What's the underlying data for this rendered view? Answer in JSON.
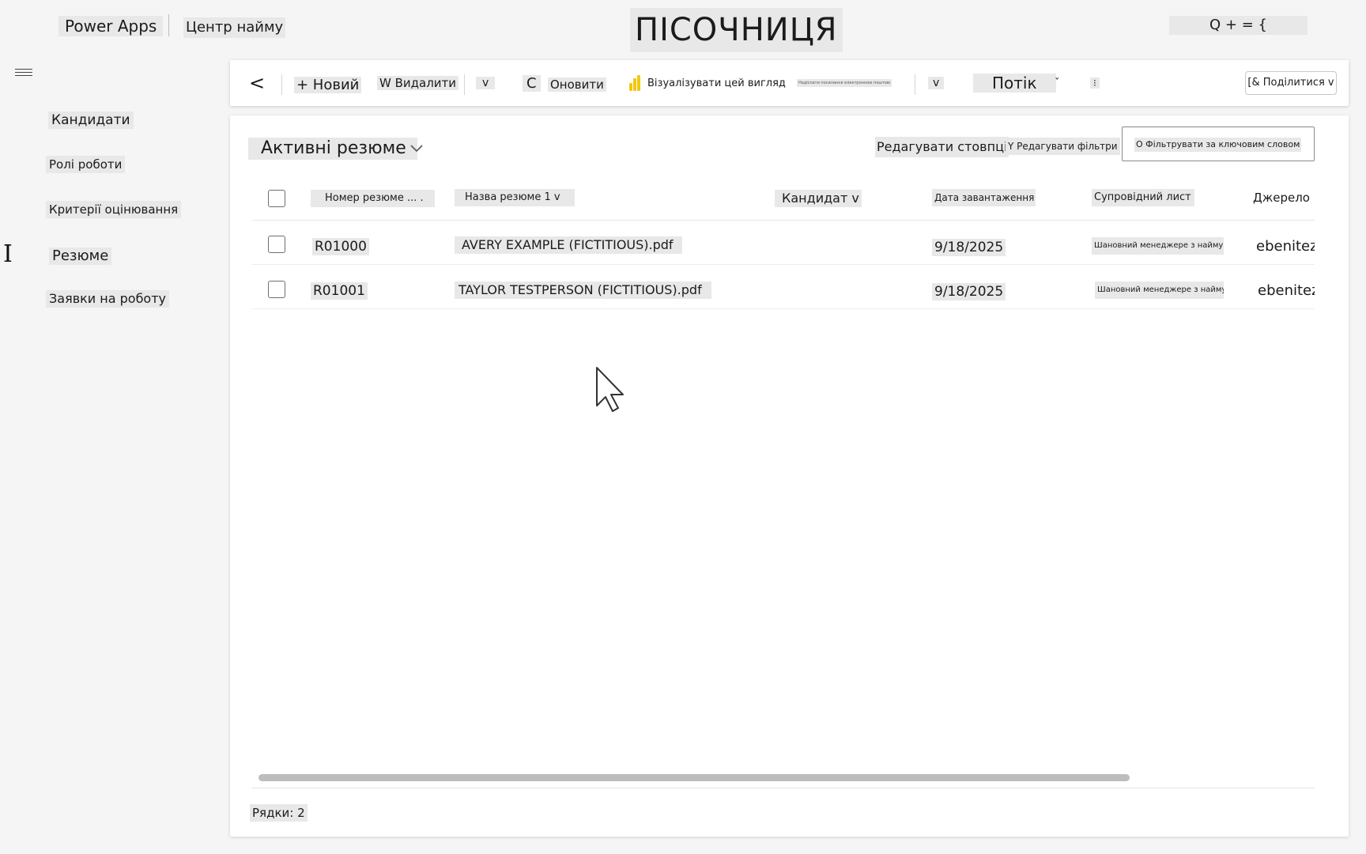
{
  "header": {
    "app_name": "Power Apps",
    "app_title": "Центр найму",
    "environment": "ПІСОЧНИЦЯ",
    "right_icons_text": "Q + = {"
  },
  "nav": {
    "menu_icon": "hamburger-icon",
    "items": [
      {
        "label": "Кандидати"
      },
      {
        "label": "Ролі роботи"
      },
      {
        "label": "Критерії оцінювання"
      },
      {
        "label": "Резюме"
      },
      {
        "label": "Заявки на роботу"
      }
    ],
    "cursor_glyph": "I"
  },
  "commandbar": {
    "back": "<",
    "new": "+ Новий",
    "delete": "W Видалити",
    "more1": "v",
    "refresh_icon": "C",
    "refresh": "Оновити",
    "visualize_icon": "powerbi-icon",
    "visualize": "Візуалізувати цей вигляд",
    "blurred": "Надіслати посилання електронною поштою",
    "more2": "v",
    "flow": "Потік",
    "flow_chev": "ˇ",
    "overflow": "⁝",
    "share": "[& Поділитися v"
  },
  "view": {
    "title": "Активні резюме",
    "edit_columns": "Редагувати стовпці",
    "edit_filters": "Y Редагувати фільтри",
    "search_placeholder": "O Фільтрувати за ключовим словом"
  },
  "grid": {
    "columns": [
      "Номер резюме ... .",
      "Назва резюме 1 v",
      "Кандидат v",
      "Дата завантаження v",
      "Супровідний лист v",
      "Джерело E"
    ],
    "rows": [
      {
        "number": "R01000",
        "name": "AVERY EXAMPLE (FICTITIOUS).pdf",
        "candidate": "",
        "date": "9/18/2025",
        "cover": "Шановний менеджере з найму ...",
        "source": "ebenitez"
      },
      {
        "number": "R01001",
        "name": "TAYLOR TESTPERSON (FICTITIOUS).pdf",
        "candidate": "",
        "date": "9/18/2025",
        "cover": "Шановний менеджере з найму ...",
        "source": "ebenitez"
      }
    ]
  },
  "footer": {
    "rows_count": "Рядки: 2"
  }
}
